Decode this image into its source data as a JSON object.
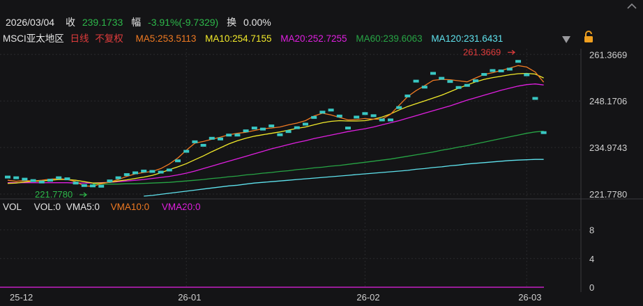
{
  "header": {
    "date": "2026/03/04",
    "close_label": "收",
    "close_value": "239.1733",
    "change_label": "幅",
    "change_value": "-3.91%(-9.7329)",
    "turnover_label": "换",
    "turnover_value": "0.00%"
  },
  "ma_legend": {
    "name": "MSCI亚太地区",
    "period": "日线",
    "adjust": "不复权",
    "ma5": "MA5:253.5113",
    "ma10": "MA10:254.7155",
    "ma20": "MA20:252.7255",
    "ma60": "MA60:239.6063",
    "ma120": "MA120:231.6431"
  },
  "vol_legend": {
    "title": "VOL",
    "vol": "VOL:0",
    "vma5": "VMA5:0",
    "vma10": "VMA10:0",
    "vma20": "VMA20:0"
  },
  "colors": {
    "background": "#141416",
    "candle": "#39c7c3",
    "ma5": "#f07a22",
    "ma10": "#f2ea2a",
    "ma20": "#e01fe0",
    "ma60": "#27a545",
    "ma120": "#5fe3ee",
    "up_text": "#e03c3c",
    "down_text": "#2db84a",
    "volume": "#c41fc4",
    "grid": "#2a2a2e"
  },
  "icons": [
    "dropdown-triangle-icon",
    "lock-icon",
    "chevron-right-icon"
  ],
  "chart_data": {
    "type": "line",
    "title": "",
    "price_axis": {
      "ticks": [
        "261.3669",
        "248.1706",
        "234.9743",
        "221.7780"
      ],
      "range": [
        220.8,
        263.0
      ]
    },
    "volume_axis": {
      "ticks": [
        "8",
        "4",
        "0"
      ],
      "range": [
        0,
        10
      ]
    },
    "x_ticks": [
      "25-12",
      "26-01",
      "26-02",
      "26-03"
    ],
    "annotations": {
      "high": "261.3669",
      "low": "221.7780"
    },
    "closes": [
      226.6,
      226.4,
      226.0,
      225.6,
      225.2,
      225.7,
      226.4,
      226.1,
      224.9,
      224.2,
      224.1,
      224.0,
      225.5,
      226.4,
      227.3,
      227.8,
      228.3,
      228.2,
      228.0,
      228.6,
      231.2,
      233.9,
      236.6,
      235.6,
      237.6,
      237.4,
      238.5,
      238.5,
      239.7,
      240.5,
      240.2,
      241.1,
      238.6,
      239.5,
      240.6,
      241.6,
      243.5,
      245.0,
      245.6,
      243.9,
      240.5,
      243.6,
      244.6,
      244.0,
      242.8,
      242.8,
      246.3,
      249.6,
      253.8,
      252.1,
      256.0,
      254.6,
      253.7,
      252.0,
      252.6,
      253.9,
      255.7,
      256.8,
      256.7,
      257.2,
      259.4,
      255.6,
      248.9,
      239.2
    ],
    "ma5": [
      225.7,
      225.4,
      225.6,
      225.5,
      225.7,
      226.0,
      226.2,
      225.9,
      225.3,
      224.1,
      224.0,
      224.7,
      225.2,
      225.9,
      226.8,
      227.5,
      227.9,
      228.2,
      229.0,
      230.3,
      232.0,
      234.2,
      236.2,
      236.7,
      237.3,
      237.9,
      238.6,
      239.0,
      239.3,
      239.8,
      240.3,
      240.5,
      240.8,
      241.4,
      241.9,
      242.6,
      243.9,
      244.7,
      244.2,
      243.5,
      242.8,
      242.9,
      243.2,
      243.0,
      243.0,
      244.4,
      246.9,
      249.4,
      251.1,
      252.5,
      254.0,
      254.3,
      254.2,
      253.9,
      253.6,
      254.7,
      255.7,
      256.2,
      256.8,
      257.5,
      258.2,
      257.8,
      256.4,
      253.5
    ],
    "ma10": [
      224.8,
      224.9,
      225.2,
      225.4,
      225.5,
      225.7,
      225.9,
      225.9,
      225.7,
      225.3,
      224.9,
      224.9,
      225.1,
      225.5,
      225.8,
      226.2,
      226.6,
      227.1,
      227.8,
      228.7,
      229.5,
      230.4,
      231.5,
      232.6,
      233.8,
      234.9,
      236.0,
      236.9,
      237.6,
      238.2,
      238.6,
      239.0,
      239.4,
      239.9,
      240.4,
      240.8,
      241.4,
      242.0,
      242.4,
      242.6,
      242.5,
      242.5,
      242.6,
      243.0,
      243.6,
      244.5,
      245.6,
      246.6,
      247.4,
      248.2,
      249.0,
      249.8,
      250.8,
      251.8,
      252.7,
      253.6,
      254.3,
      254.8,
      255.2,
      255.6,
      255.9,
      256.0,
      255.8,
      254.7
    ],
    "ma20": [
      225.0,
      225.0,
      225.0,
      225.0,
      225.0,
      225.0,
      225.0,
      225.0,
      224.9,
      224.9,
      224.9,
      225.0,
      225.1,
      225.3,
      225.5,
      225.7,
      225.9,
      226.2,
      226.5,
      226.8,
      227.2,
      227.7,
      228.3,
      229.0,
      229.7,
      230.4,
      231.1,
      231.8,
      232.5,
      233.2,
      233.9,
      234.6,
      235.2,
      235.8,
      236.4,
      236.9,
      237.5,
      238.0,
      238.5,
      239.0,
      239.5,
      239.9,
      240.3,
      240.8,
      241.4,
      242.0,
      242.6,
      243.3,
      244.0,
      244.7,
      245.4,
      246.1,
      246.8,
      247.6,
      248.4,
      249.1,
      249.8,
      250.5,
      251.2,
      251.8,
      252.4,
      252.8,
      253.0,
      252.7
    ],
    "ma60": [
      null,
      null,
      null,
      null,
      null,
      null,
      null,
      null,
      null,
      null,
      224.6,
      224.6,
      224.6,
      224.6,
      224.7,
      224.7,
      224.8,
      224.9,
      225.0,
      225.1,
      225.3,
      225.5,
      225.7,
      225.9,
      226.2,
      226.4,
      226.7,
      226.9,
      227.2,
      227.4,
      227.7,
      227.9,
      228.2,
      228.4,
      228.7,
      228.9,
      229.2,
      229.4,
      229.7,
      229.9,
      230.2,
      230.5,
      230.8,
      231.1,
      231.4,
      231.7,
      232.1,
      232.5,
      232.9,
      233.3,
      233.7,
      234.2,
      234.6,
      235.1,
      235.5,
      236.0,
      236.5,
      237.0,
      237.5,
      238.0,
      238.5,
      239.0,
      239.4,
      239.6
    ],
    "ma120": [
      null,
      null,
      null,
      null,
      null,
      null,
      null,
      null,
      null,
      null,
      null,
      null,
      null,
      null,
      null,
      null,
      221.2,
      221.4,
      221.7,
      222.0,
      222.3,
      222.6,
      222.9,
      223.2,
      223.5,
      223.8,
      224.1,
      224.3,
      224.6,
      224.9,
      225.1,
      225.3,
      225.5,
      225.7,
      225.9,
      226.1,
      226.3,
      226.5,
      226.7,
      226.9,
      227.1,
      227.3,
      227.5,
      227.7,
      227.9,
      228.1,
      228.3,
      228.5,
      228.8,
      229.0,
      229.3,
      229.5,
      229.8,
      230.0,
      230.3,
      230.5,
      230.7,
      230.9,
      231.1,
      231.3,
      231.4,
      231.5,
      231.6,
      231.6
    ],
    "volume": 0
  }
}
